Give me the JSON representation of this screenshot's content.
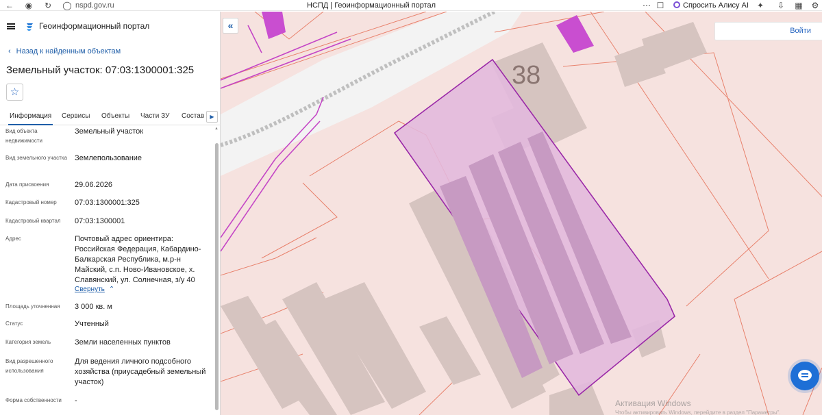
{
  "browser": {
    "url": "nspd.gov.ru",
    "tab_title": "НСПД | Геоинформационный портал",
    "alice_label": "Спросить Алису AI"
  },
  "header": {
    "portal_title": "Геоинформационный портал"
  },
  "panel": {
    "back_link": "Назад к найденным объектам",
    "title": "Земельный участок: 07:03:1300001:325",
    "tabs": [
      "Информация",
      "Сервисы",
      "Объекты",
      "Части ЗУ",
      "Состав"
    ],
    "collapse_link": "Свернуть",
    "fields": [
      {
        "label": "Вид объекта недвижимости",
        "value": "Земельный участок"
      },
      {
        "label": "Вид земельного участка",
        "value": "Землепользование"
      },
      {
        "label": "Дата присвоения",
        "value": "29.06.2026"
      },
      {
        "label": "Кадастровый номер",
        "value": "07:03:1300001:325"
      },
      {
        "label": "Кадастровый квартал",
        "value": "07:03:1300001"
      },
      {
        "label": "Адрес",
        "value": "Почтовый адрес ориентира: Российская Федерация, Кабардино-Балкарская Республика, м.р-н Майский, с.п. Ново-Ивановское, х. Славянский, ул. Солнечная, з/у 40"
      },
      {
        "label": "Площадь уточненная",
        "value": "3 000 кв. м"
      },
      {
        "label": "Статус",
        "value": "Учтенный"
      },
      {
        "label": "Категория земель",
        "value": "Земли населенных пунктов"
      },
      {
        "label": "Вид разрешенного использования",
        "value": "Для ведения личного подсобного хозяйства (приусадебный земельный участок)"
      },
      {
        "label": "Форма собственности",
        "value": "-"
      }
    ]
  },
  "map": {
    "search_button": "Войти",
    "house_number": "38",
    "watermark_title": "Активация Windows",
    "watermark_subtitle": "Чтобы активировать Windows, перейдите в раздел \"Параметры\"."
  },
  "colors": {
    "accent": "#1f5ea8",
    "parcel_fill": "#e2b8dd",
    "parcel_stroke": "#9b2aa8",
    "map_bg": "#f6e2df"
  }
}
